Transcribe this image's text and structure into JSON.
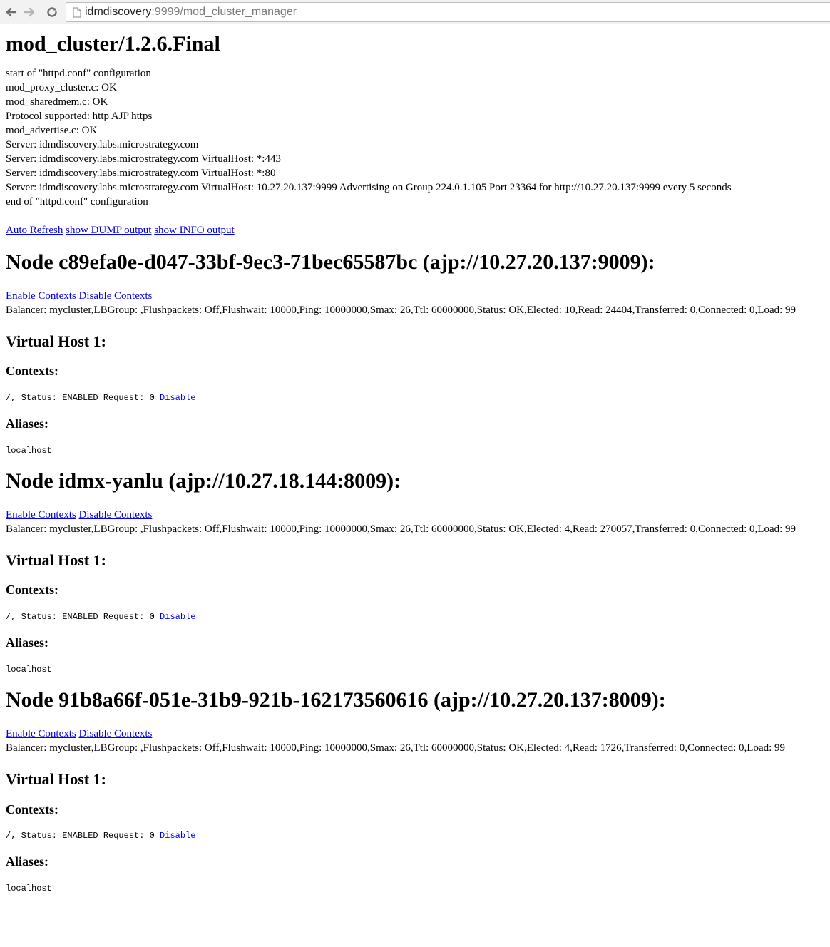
{
  "browser": {
    "url_host": "idmdiscovery",
    "url_rest": ":9999/mod_cluster_manager"
  },
  "page": {
    "title": "mod_cluster/1.2.6.Final",
    "config_lines": [
      "start of \"httpd.conf\" configuration",
      "mod_proxy_cluster.c: OK",
      "mod_sharedmem.c: OK",
      "Protocol supported: http AJP https",
      "mod_advertise.c: OK",
      "Server: idmdiscovery.labs.microstrategy.com",
      "Server: idmdiscovery.labs.microstrategy.com VirtualHost: *:443",
      "Server: idmdiscovery.labs.microstrategy.com VirtualHost: *:80",
      "Server: idmdiscovery.labs.microstrategy.com VirtualHost: 10.27.20.137:9999 Advertising on Group 224.0.1.105 Port 23364 for http://10.27.20.137:9999 every 5 seconds",
      "end of \"httpd.conf\" configuration"
    ],
    "top_links": {
      "auto_refresh": "Auto Refresh",
      "show_dump": "show DUMP output",
      "show_info": "show INFO output"
    },
    "nodes": [
      {
        "title": "Node c89efa0e-d047-33bf-9ec3-71bec65587bc (ajp://10.27.20.137:9009):",
        "enable": "Enable Contexts",
        "disable": "Disable Contexts",
        "balancer": "Balancer: mycluster,LBGroup: ,Flushpackets: Off,Flushwait: 10000,Ping: 10000000,Smax: 26,Ttl: 60000000,Status: OK,Elected: 10,Read: 24404,Transferred: 0,Connected: 0,Load: 99",
        "vhost": "Virtual Host 1:",
        "contexts_label": "Contexts:",
        "context_line": "/, Status: ENABLED Request: 0 ",
        "context_action": "Disable",
        "aliases_label": "Aliases:",
        "alias": "localhost"
      },
      {
        "title": "Node idmx-yanlu (ajp://10.27.18.144:8009):",
        "enable": "Enable Contexts",
        "disable": "Disable Contexts",
        "balancer": "Balancer: mycluster,LBGroup: ,Flushpackets: Off,Flushwait: 10000,Ping: 10000000,Smax: 26,Ttl: 60000000,Status: OK,Elected: 4,Read: 270057,Transferred: 0,Connected: 0,Load: 99",
        "vhost": "Virtual Host 1:",
        "contexts_label": "Contexts:",
        "context_line": "/, Status: ENABLED Request: 0 ",
        "context_action": "Disable",
        "aliases_label": "Aliases:",
        "alias": "localhost"
      },
      {
        "title": "Node 91b8a66f-051e-31b9-921b-162173560616 (ajp://10.27.20.137:8009):",
        "enable": "Enable Contexts",
        "disable": "Disable Contexts",
        "balancer": "Balancer: mycluster,LBGroup: ,Flushpackets: Off,Flushwait: 10000,Ping: 10000000,Smax: 26,Ttl: 60000000,Status: OK,Elected: 4,Read: 1726,Transferred: 0,Connected: 0,Load: 99",
        "vhost": "Virtual Host 1:",
        "contexts_label": "Contexts:",
        "context_line": "/, Status: ENABLED Request: 0 ",
        "context_action": "Disable",
        "aliases_label": "Aliases:",
        "alias": "localhost"
      }
    ]
  }
}
